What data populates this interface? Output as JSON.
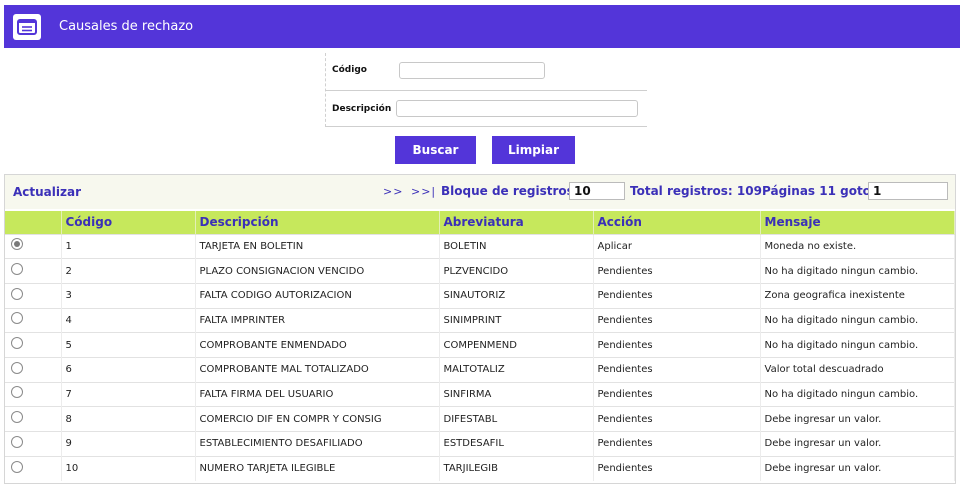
{
  "header": {
    "title": "Causales de rechazo",
    "icon": "list-icon",
    "color": "#5335d9"
  },
  "form": {
    "codigo_label": "Código",
    "codigo_value": "",
    "descripcion_label": "Descripción",
    "descripcion_value": "",
    "search_label": "Buscar",
    "clear_label": "Limpiar"
  },
  "toolbar": {
    "refresh_label": "Actualizar",
    "next_label": ">>",
    "last_label": ">>|",
    "block_label": "Bloque de registros:",
    "block_value": "10",
    "total_label": "Total registros: 109",
    "pages_label": "Páginas 11 goto:",
    "goto_value": "1"
  },
  "table": {
    "columns": [
      "Código",
      "Descripción",
      "Abreviatura",
      "Acción",
      "Mensaje"
    ],
    "rows": [
      {
        "codigo": "1",
        "descripcion": "TARJETA EN BOLETIN",
        "abreviatura": "BOLETIN",
        "accion": "Aplicar",
        "mensaje": "Moneda no existe."
      },
      {
        "codigo": "2",
        "descripcion": "PLAZO CONSIGNACION VENCIDO",
        "abreviatura": "PLZVENCIDO",
        "accion": "Pendientes",
        "mensaje": "No ha digitado ningun cambio."
      },
      {
        "codigo": "3",
        "descripcion": "FALTA CODIGO AUTORIZACION",
        "abreviatura": "SINAUTORIZ",
        "accion": "Pendientes",
        "mensaje": "Zona geografica inexistente"
      },
      {
        "codigo": "4",
        "descripcion": "FALTA IMPRINTER",
        "abreviatura": "SINIMPRINT",
        "accion": "Pendientes",
        "mensaje": "No ha digitado ningun cambio."
      },
      {
        "codigo": "5",
        "descripcion": "COMPROBANTE ENMENDADO",
        "abreviatura": "COMPENMEND",
        "accion": "Pendientes",
        "mensaje": "No ha digitado ningun cambio."
      },
      {
        "codigo": "6",
        "descripcion": "COMPROBANTE MAL TOTALIZADO",
        "abreviatura": "MALTOTALIZ",
        "accion": "Pendientes",
        "mensaje": "Valor total descuadrado"
      },
      {
        "codigo": "7",
        "descripcion": "FALTA FIRMA DEL USUARIO",
        "abreviatura": "SINFIRMA",
        "accion": "Pendientes",
        "mensaje": "No ha digitado ningun cambio."
      },
      {
        "codigo": "8",
        "descripcion": "COMERCIO DIF EN COMPR Y CONSIG",
        "abreviatura": "DIFESTABL",
        "accion": "Pendientes",
        "mensaje": "Debe ingresar un valor."
      },
      {
        "codigo": "9",
        "descripcion": "ESTABLECIMIENTO DESAFILIADO",
        "abreviatura": "ESTDESAFIL",
        "accion": "Pendientes",
        "mensaje": "Debe ingresar un valor."
      },
      {
        "codigo": "10",
        "descripcion": "NUMERO TARJETA ILEGIBLE",
        "abreviatura": "TARJILEGIB",
        "accion": "Pendientes",
        "mensaje": "Debe ingresar un valor."
      }
    ],
    "selected_index": 0
  }
}
